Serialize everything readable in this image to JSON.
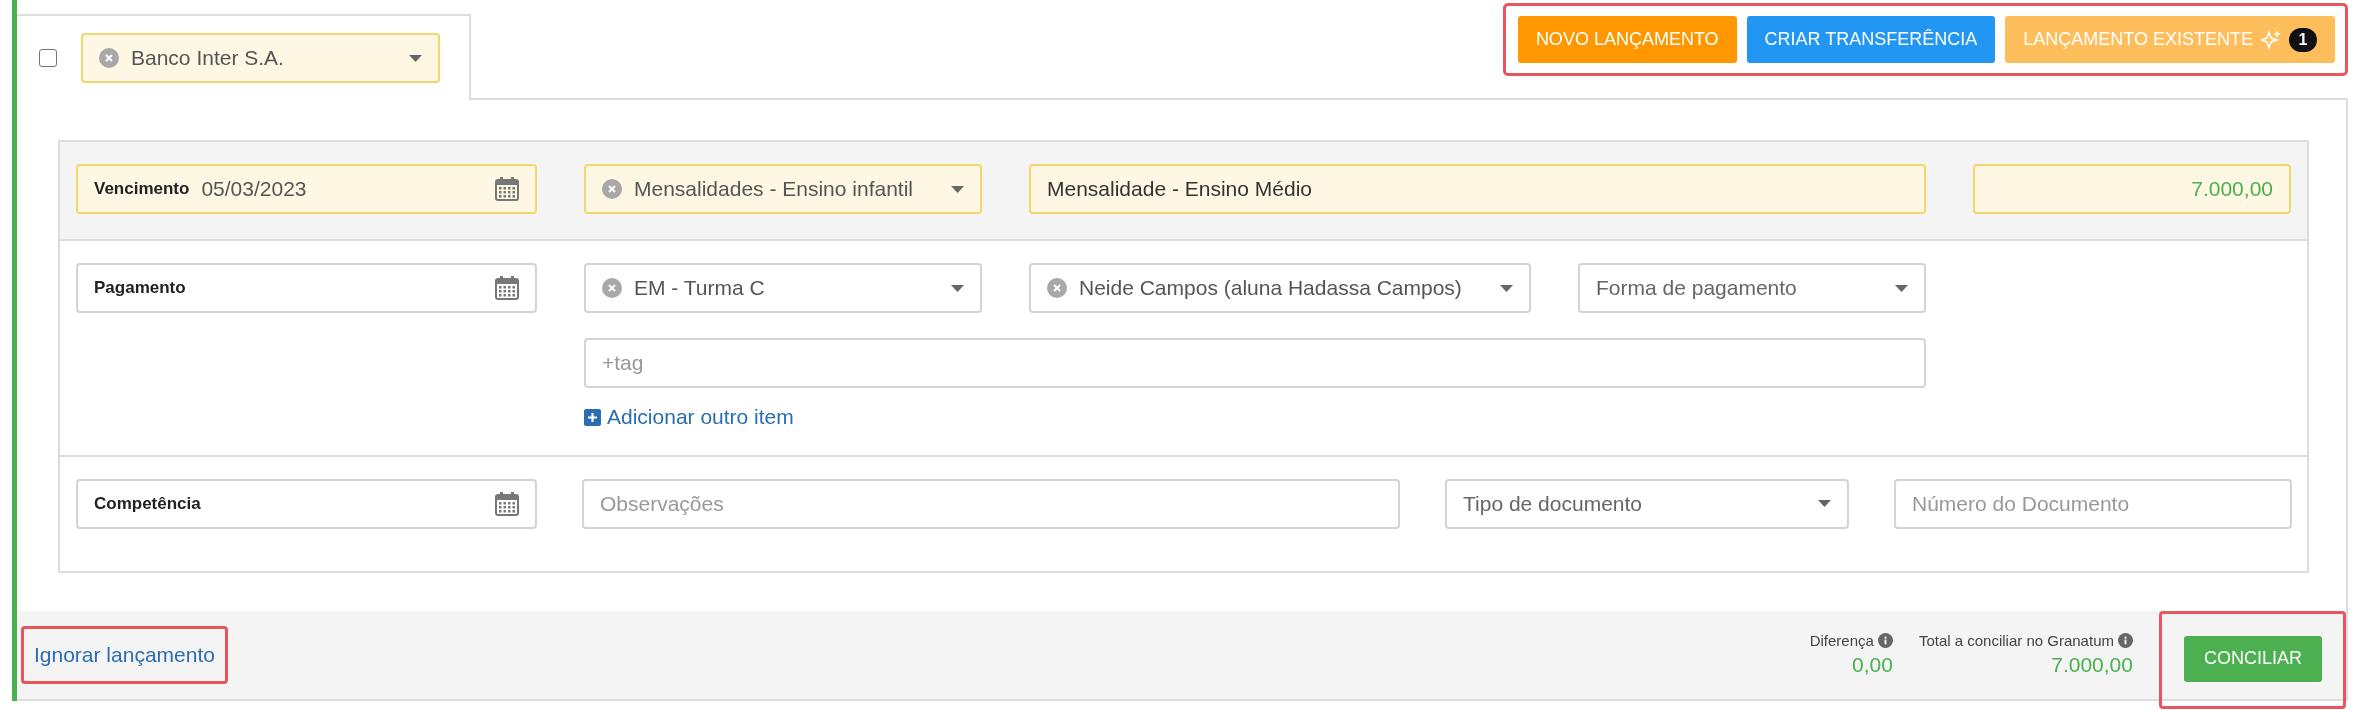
{
  "select_checkbox": {
    "checked": false
  },
  "account_select": {
    "value": "Banco Inter S.A.",
    "highlighted": true
  },
  "actions": [
    {
      "label": "NOVO LANÇAMENTO",
      "kind": "new"
    },
    {
      "label": "CRIAR TRANSFERÊNCIA",
      "kind": "transfer"
    },
    {
      "label": "LANÇAMENTO EXISTENTE",
      "kind": "existing",
      "badge": "1"
    }
  ],
  "rows": [
    {
      "kind": "main",
      "fields": [
        {
          "kind": "date",
          "label": "Vencimento",
          "value": "05/03/2023",
          "highlighted": true
        },
        {
          "kind": "select",
          "value": "Mensalidades - Ensino infantil",
          "highlighted": true
        },
        {
          "kind": "input",
          "value": "Mensalidade - Ensino Médio",
          "highlighted": true
        },
        {
          "kind": "amount",
          "value": "7.000,00",
          "highlighted": true
        }
      ]
    },
    {
      "kind": "detail",
      "fields": [
        {
          "kind": "date",
          "label": "Pagamento",
          "highlighted": false
        },
        {
          "kind": "select",
          "value": "EM - Turma C",
          "highlighted": false
        },
        {
          "kind": "select",
          "value": "Neide Campos (aluna Hadassa Campos)",
          "highlighted": false
        },
        {
          "kind": "picker",
          "placeholder": "Forma de pagamento",
          "highlighted": false
        }
      ],
      "tags": {
        "placeholder": "+tag"
      },
      "add_item_link": "Adicionar outro item"
    },
    {
      "kind": "detail",
      "fields": [
        {
          "kind": "date",
          "label": "Competência",
          "highlighted": false
        },
        {
          "kind": "input",
          "placeholder": "Observações",
          "highlighted": false
        },
        {
          "kind": "picker",
          "placeholder": "Tipo de documento",
          "highlighted": false
        },
        {
          "kind": "input",
          "placeholder": "Número do Documento",
          "highlighted": false
        }
      ]
    }
  ],
  "footer": {
    "ignore_link": "Ignorar lançamento",
    "difference": {
      "label": "Diferença",
      "value": "0,00"
    },
    "total": {
      "label": "Total a conciliar no Granatum",
      "value": "7.000,00"
    },
    "submit": "CONCILIAR"
  }
}
